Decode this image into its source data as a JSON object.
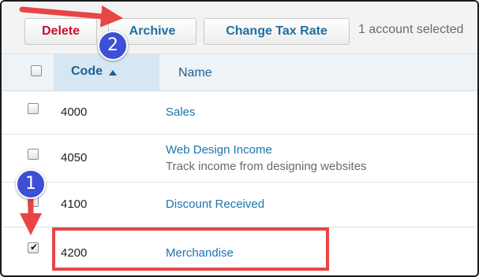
{
  "toolbar": {
    "delete_label": "Delete",
    "archive_label": "Archive",
    "change_tax_rate_label": "Change Tax Rate",
    "selection_status": "1 account selected"
  },
  "table": {
    "columns": {
      "code": "Code",
      "name": "Name"
    },
    "sort": {
      "column": "code",
      "direction": "ascending"
    },
    "rows": [
      {
        "code": "4000",
        "name": "Sales",
        "description": "",
        "checked": false
      },
      {
        "code": "4050",
        "name": "Web Design Income",
        "description": "Track income from designing websites",
        "checked": false
      },
      {
        "code": "4100",
        "name": "Discount Received",
        "description": "",
        "checked": false
      },
      {
        "code": "4200",
        "name": "Merchandise",
        "description": "",
        "checked": true
      }
    ]
  },
  "annotations": {
    "step_1": "1",
    "step_2": "2",
    "badge_color": "#3c4fd6",
    "arrow_color": "#e84545",
    "highlight_color": "#e84545"
  }
}
